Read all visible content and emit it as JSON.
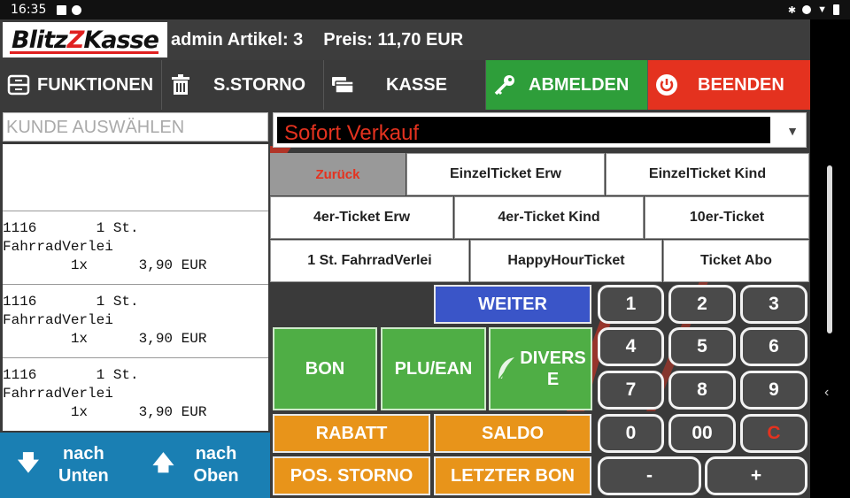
{
  "statusbar": {
    "time": "16:35",
    "icons_left": [
      "image-icon",
      "p-icon"
    ],
    "icons_right": [
      "bluetooth-icon",
      "alarm-icon",
      "wifi-icon",
      "battery-icon"
    ]
  },
  "header": {
    "logo": "BlitzKasse",
    "info": "admin Artikel: 3",
    "price": "Preis: 11,70 EUR"
  },
  "toolbar": {
    "funktionen": "FUNKTIONEN",
    "storno": "S.STORNO",
    "kasse": "KASSE",
    "abmelden": "ABMELDEN",
    "beenden": "BEENDEN"
  },
  "customer": {
    "placeholder": "KUNDE AUSWÄHLEN"
  },
  "items": [
    {
      "line1": "1116       1 St.",
      "line2": "FahrradVerlei",
      "line3": "        1x      3,90 EUR"
    },
    {
      "line1": "1116       1 St.",
      "line2": "FahrradVerlei",
      "line3": "        1x      3,90 EUR"
    },
    {
      "line1": "1116       1 St.",
      "line2": "FahrradVerlei",
      "line3": "        1x      3,90 EUR"
    }
  ],
  "nav": {
    "down_line1": "nach",
    "down_line2": "Unten",
    "up_line1": "nach",
    "up_line2": "Oben"
  },
  "dropdown": {
    "selected": "Sofort Verkauf"
  },
  "tickets": {
    "back": "Zurück",
    "einzel_erw": "EinzelTicket Erw",
    "einzel_kind": "EinzelTicket Kind",
    "vier_erw": "4er-Ticket Erw",
    "vier_kind": "4er-Ticket Kind",
    "zehn": "10er-Ticket",
    "fahrrad": "1 St. FahrradVerlei",
    "happyhour": "HappyHourTicket",
    "abo": "Ticket Abo"
  },
  "actions": {
    "weiter": "WEITER",
    "bon": "BON",
    "plu": "PLU/EAN",
    "diverse_line1": "DIVERS",
    "diverse_line2": "E",
    "rabatt": "RABATT",
    "saldo": "SALDO",
    "pos_storno": "POS. STORNO",
    "letzter_bon": "LETZTER BON"
  },
  "keypad": {
    "k1": "1",
    "k2": "2",
    "k3": "3",
    "k4": "4",
    "k5": "5",
    "k6": "6",
    "k7": "7",
    "k8": "8",
    "k9": "9",
    "k0": "0",
    "k00": "00",
    "kc": "C",
    "kminus": "-",
    "kplus": "+"
  },
  "colors": {
    "green": "#2e9e3a",
    "red": "#e4321f",
    "blue": "#3a55c8",
    "orange": "#e8941a",
    "navblue": "#1a7fb3"
  }
}
